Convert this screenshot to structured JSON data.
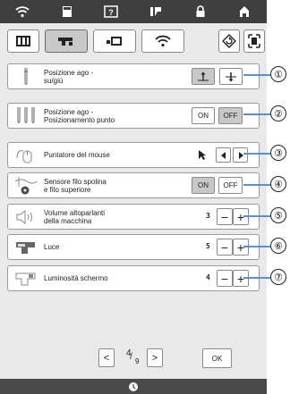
{
  "top_icons": [
    "wifi-icon",
    "page-icon",
    "help-icon",
    "stitch-icon",
    "lock-icon",
    "home-icon"
  ],
  "tabs": [
    "machine-book-icon",
    "sewing-settings-icon",
    "embroidery-icon",
    "wireless-icon",
    "reset-icon",
    "frame-icon"
  ],
  "rows": [
    {
      "label_l1": "Posizione ago -",
      "label_l2": "su/giù",
      "callout": "①"
    },
    {
      "label_l1": "Posizione ago -",
      "label_l2": "Posizionamento punto",
      "on": "ON",
      "off": "OFF",
      "callout": "②"
    },
    {
      "label_l1": "Puntatore del mouse",
      "callout": "③"
    },
    {
      "label_l1": "Sensore filo spolina",
      "label_l2": "e filo superiore",
      "on": "ON",
      "off": "OFF",
      "callout": "④"
    },
    {
      "label_l1": "Volume altoparlanti",
      "label_l2": "della macchina",
      "value": "3",
      "minus": "−",
      "plus": "+",
      "callout": "⑤"
    },
    {
      "label_l1": "Luce",
      "value": "5",
      "minus": "−",
      "plus": "+",
      "callout": "⑥"
    },
    {
      "label_l1": "Luminosità schermo",
      "value": "4",
      "minus": "−",
      "plus": "+",
      "callout": "⑦"
    }
  ],
  "pager": {
    "current": "4",
    "total": "9",
    "prev": "<",
    "next": ">"
  },
  "ok_label": "OK",
  "colors": {
    "topbar": "#3f3f3f",
    "screen_bg": "#e9e9e9",
    "callout_line": "#5a8fd0",
    "active_btn": "#c8c8c8"
  }
}
